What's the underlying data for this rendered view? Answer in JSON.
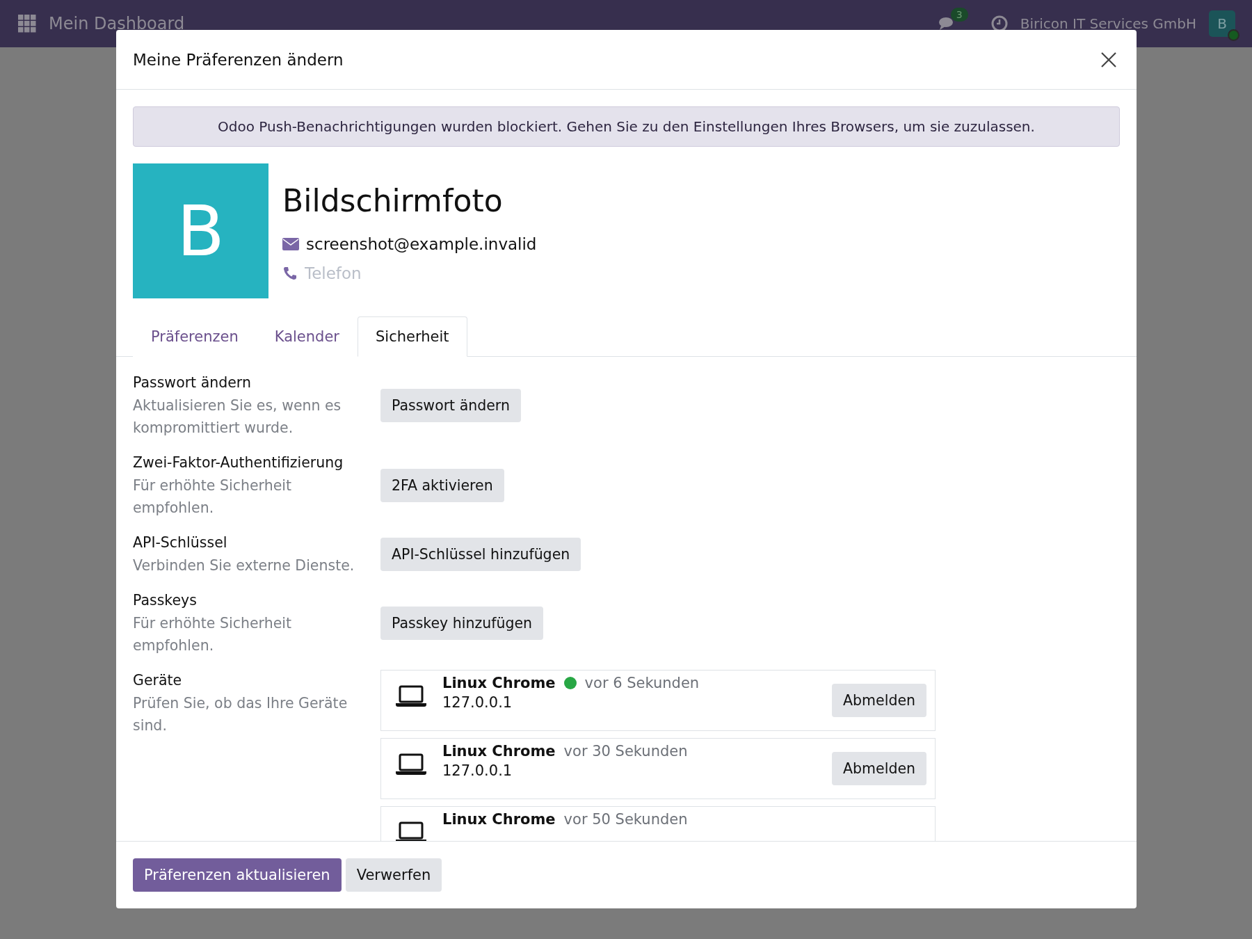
{
  "navbar": {
    "title": "Mein Dashboard",
    "message_count": "3",
    "company": "Biricon IT Services GmbH",
    "avatar_letter": "B"
  },
  "dialog": {
    "title": "Meine Präferenzen ändern",
    "alert": "Odoo Push-Benachrichtigungen wurden blockiert. Gehen Sie zu den Einstellungen Ihres Browsers, um sie zuzulassen.",
    "profile": {
      "avatar_letter": "B",
      "name": "Bildschirmfoto",
      "email": "screenshot@example.invalid",
      "phone_placeholder": "Telefon"
    },
    "tabs": [
      {
        "label": "Präferenzen",
        "selected": false
      },
      {
        "label": "Kalender",
        "selected": false
      },
      {
        "label": "Sicherheit",
        "selected": true
      }
    ],
    "sections": [
      {
        "kind": "button",
        "title": "Passwort ändern",
        "description": "Aktualisieren Sie es, wenn es kompromittiert wurde.",
        "button": "Passwort ändern"
      },
      {
        "kind": "button",
        "title": "Zwei-Faktor-Authentifizierung",
        "description": "Für erhöhte Sicherheit empfohlen.",
        "button": "2FA aktivieren"
      },
      {
        "kind": "button",
        "title": "API-Schlüssel",
        "description": "Verbinden Sie externe Dienste.",
        "button": "API-Schlüssel hinzufügen"
      },
      {
        "kind": "button",
        "title": "Passkeys",
        "description": "Für erhöhte Sicherheit empfohlen.",
        "button": "Passkey hinzufügen"
      },
      {
        "kind": "devices",
        "title": "Geräte",
        "description": "Prüfen Sie, ob das Ihre Geräte sind."
      }
    ],
    "devices": [
      {
        "name": "Linux Chrome",
        "online": true,
        "last_seen": "vor 6 Sekunden",
        "ip": "127.0.0.1",
        "button": "Abmelden"
      },
      {
        "name": "Linux Chrome",
        "online": false,
        "last_seen": "vor 30 Sekunden",
        "ip": "127.0.0.1",
        "button": "Abmelden"
      },
      {
        "name": "Linux Chrome",
        "online": false,
        "last_seen": "vor 50 Sekunden"
      }
    ],
    "footer_buttons": [
      {
        "label": "Präferenzen aktualisieren",
        "primary": true
      },
      {
        "label": "Verwerfen",
        "primary": false
      }
    ]
  }
}
